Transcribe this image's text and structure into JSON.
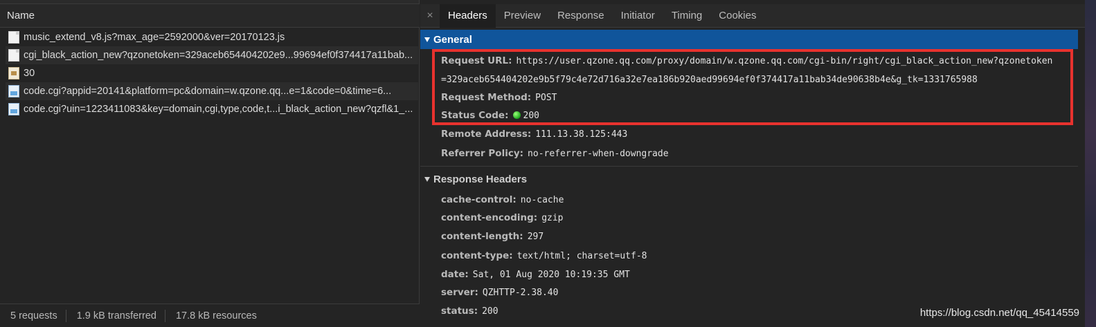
{
  "request_list": {
    "column_header": "Name",
    "rows": [
      {
        "icon": "document-icon",
        "name": "music_extend_v8.js?max_age=2592000&ver=20170123.js"
      },
      {
        "icon": "document-icon",
        "name": "cgi_black_action_new?qzonetoken=329aceb654404202e9...99694ef0f374417a11bab..."
      },
      {
        "icon": "image-file-icon",
        "name": "30"
      },
      {
        "icon": "image-icon",
        "name": "code.cgi?appid=20141&platform=pc&domain=w.qzone.qq...e=1&code=0&time=6..."
      },
      {
        "icon": "image-icon",
        "name": "code.cgi?uin=1223411083&key=domain,cgi,type,code,t...i_black_action_new?qzfl&1_..."
      }
    ]
  },
  "status_bar": {
    "requests": "5 requests",
    "transferred": "1.9 kB transferred",
    "resources": "17.8 kB resources"
  },
  "tabs": {
    "close": "×",
    "items": [
      "Headers",
      "Preview",
      "Response",
      "Initiator",
      "Timing",
      "Cookies"
    ],
    "active": "Headers"
  },
  "general": {
    "title": "General",
    "request_url_label": "Request URL:",
    "request_url_line1": "https://user.qzone.qq.com/proxy/domain/w.qzone.qq.com/cgi-bin/right/cgi_black_action_new?qzonetoken",
    "request_url_line2": "=329aceb654404202e9b5f79c4e72d716a32e7ea186b920aed99694ef0f374417a11bab34de90638b4e&g_tk=1331765988",
    "request_method_label": "Request Method:",
    "request_method": "POST",
    "status_code_label": "Status Code:",
    "status_code": "200",
    "remote_address_label": "Remote Address:",
    "remote_address": "111.13.38.125:443",
    "referrer_policy_label": "Referrer Policy:",
    "referrer_policy": "no-referrer-when-downgrade"
  },
  "response_headers": {
    "title": "Response Headers",
    "items": [
      {
        "key": "cache-control:",
        "value": "no-cache"
      },
      {
        "key": "content-encoding:",
        "value": "gzip"
      },
      {
        "key": "content-length:",
        "value": "297"
      },
      {
        "key": "content-type:",
        "value": "text/html; charset=utf-8"
      },
      {
        "key": "date:",
        "value": "Sat, 01 Aug 2020 10:19:35 GMT"
      },
      {
        "key": "server:",
        "value": "QZHTTP-2.38.40"
      },
      {
        "key": "status:",
        "value": "200"
      }
    ]
  },
  "watermark": "https://blog.csdn.net/qq_45414559",
  "colors": {
    "background": "#242424",
    "general_header": "#10559b",
    "highlight_box": "#e8322e",
    "status_green": "#1ca81c"
  }
}
